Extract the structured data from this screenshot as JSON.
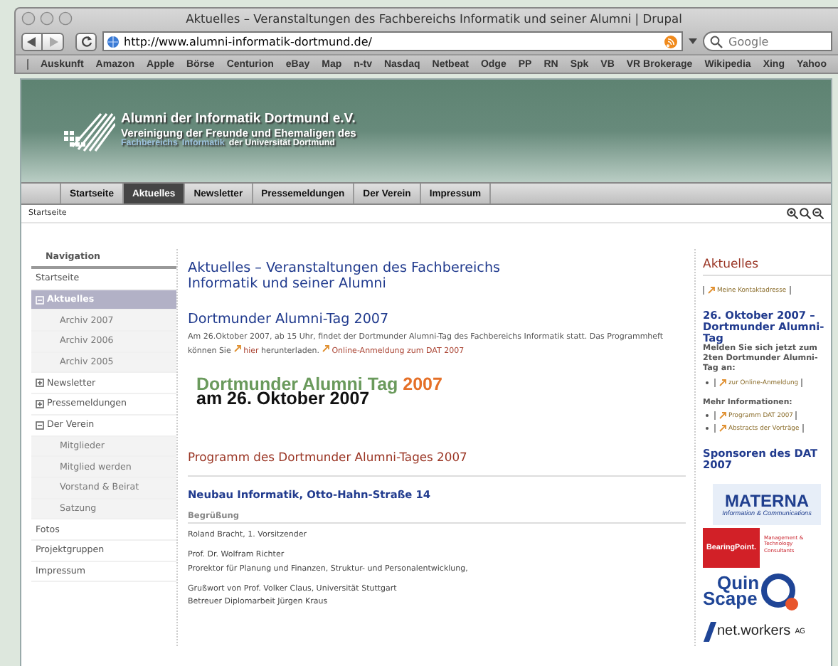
{
  "window": {
    "title": "Aktuelles – Veranstaltungen des Fachbereichs Informatik und seiner Alumni | Drupal"
  },
  "toolbar": {
    "url": "http://www.alumni-informatik-dortmund.de/",
    "search_placeholder": "Google"
  },
  "bookmarks": [
    "Auskunft",
    "Amazon",
    "Apple",
    "Börse",
    "Centurion",
    "eBay",
    "Map",
    "n-tv",
    "Nasdaq",
    "Netbeat",
    "Odge",
    "PP",
    "RN",
    "Spk",
    "VB",
    "VR Brokerage",
    "Wikipedia",
    "Xing",
    "Yahoo"
  ],
  "site": {
    "title": "Alumni der Informatik Dortmund e.V.",
    "subtitle": "Vereinigung der Freunde und Ehemaligen des",
    "subtitle_line2": [
      {
        "text": "Fachbereichs",
        "highlight": true
      },
      {
        "text": "Informatik",
        "highlight": true
      },
      {
        "text": "der Universität Dortmund",
        "highlight": false
      }
    ]
  },
  "tabs": [
    {
      "label": "Startseite",
      "selected": false
    },
    {
      "label": "Aktuelles",
      "selected": true
    },
    {
      "label": "Newsletter",
      "selected": false
    },
    {
      "label": "Pressemeldungen",
      "selected": false
    },
    {
      "label": "Der Verein",
      "selected": false
    },
    {
      "label": "Impressum",
      "selected": false
    }
  ],
  "breadcrumb": "Startseite",
  "navigation": {
    "title": "Navigation",
    "items": [
      {
        "label": "Startseite",
        "selected": false
      },
      {
        "label": "Aktuelles",
        "selected": true,
        "expanded": true,
        "children": [
          {
            "label": "Archiv 2007",
            "selected": false
          },
          {
            "label": "Archiv 2006",
            "selected": false
          },
          {
            "label": "Archiv 2005",
            "selected": false
          }
        ]
      },
      {
        "label": "Newsletter",
        "selected": false,
        "expanded": false
      },
      {
        "label": "Pressemeldungen",
        "selected": false,
        "expanded": false
      },
      {
        "label": "Der Verein",
        "selected": false,
        "expanded": true,
        "children": [
          {
            "label": "Mitglieder",
            "selected": false
          },
          {
            "label": "Mitglied werden",
            "selected": false
          },
          {
            "label": "Vorstand & Beirat",
            "selected": false
          },
          {
            "label": "Satzung",
            "selected": false
          }
        ]
      },
      {
        "label": "Fotos",
        "selected": false
      },
      {
        "label": "Projektgruppen",
        "selected": false
      },
      {
        "label": "Impressum",
        "selected": false
      }
    ]
  },
  "main": {
    "heading": "Aktuelles – Veranstaltungen des Fachbereichs Informatik und seiner Alumni",
    "article": {
      "title": "Dortmunder Alumni-Tag 2007",
      "paragraph": [
        {
          "kind": "text",
          "text": "Am 26.Oktober 2007, ab 15 Uhr, findet der Dortmunder Alumni-Tag des Fachbereichs Informatik statt. Das Programmheft können Sie "
        },
        {
          "kind": "link",
          "text": "hier"
        },
        {
          "kind": "text",
          "text": " herunterladen. "
        },
        {
          "kind": "link",
          "text": "Online-Anmeldung zum DAT 2007"
        }
      ]
    },
    "banner": {
      "line1": "Dortmunder Alumni Tag",
      "year": "2007",
      "line2": "am 26. Oktober 2007"
    },
    "program": {
      "title": "Programm des Dortmunder Alumni-Tages 2007",
      "location": "Neubau Informatik, Otto-Hahn-Straße 14",
      "section": "Begrüßung",
      "entries": [
        [
          "Roland Bracht, 1. Vorsitzender"
        ],
        [
          "Prof. Dr. Wolfram Richter",
          "Prorektor für Planung und Finanzen, Struktur- und Personalentwicklung,"
        ],
        [
          "Grußwort von Prof. Volker Claus, Universität Stuttgart",
          "Betreuer Diplomarbeit Jürgen Kraus"
        ]
      ]
    }
  },
  "sidebar": {
    "title": "Aktuelles",
    "contact_link": "Meine Kontaktadresse",
    "event_title": "26. Oktober 2007 – Dortmunder Alumni-Tag",
    "event_text": "Melden Sie sich jetzt zum 2ten Dortmunder Alumni-Tag an:",
    "event_links": [
      "zur Online-Anmeldung"
    ],
    "more_label": "Mehr Informationen:",
    "more_links": [
      "Programm DAT 2007",
      "Abstracts der Vorträge"
    ],
    "sponsors_title": "Sponsoren des DAT 2007",
    "sponsors": [
      {
        "kind": "materna",
        "name": "MATERNA",
        "tagline": "Information & Communications"
      },
      {
        "kind": "bearingpoint",
        "name": "BearingPoint.",
        "tagline": "Management & Technology Consultants"
      },
      {
        "kind": "quinscape",
        "name": "Quin",
        "name2": "Scape"
      },
      {
        "kind": "networkers",
        "name": "net.workers",
        "tagline": "AG"
      }
    ]
  }
}
